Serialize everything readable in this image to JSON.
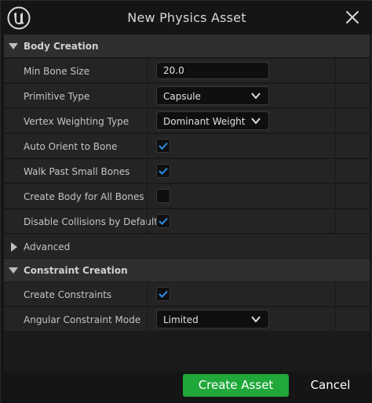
{
  "window": {
    "title": "New Physics Asset",
    "accent_color": "#20a83a",
    "check_color": "#2f8fe6"
  },
  "body_creation": {
    "title": "Body Creation",
    "min_bone_size": {
      "label": "Min Bone Size",
      "value": "20.0"
    },
    "primitive_type": {
      "label": "Primitive Type",
      "value": "Capsule"
    },
    "vertex_weighting_type": {
      "label": "Vertex Weighting Type",
      "value": "Dominant Weight"
    },
    "auto_orient": {
      "label": "Auto Orient to Bone",
      "checked": true
    },
    "walk_past_small": {
      "label": "Walk Past Small Bones",
      "checked": true
    },
    "create_body_all": {
      "label": "Create Body for All Bones",
      "checked": false
    },
    "disable_collisions": {
      "label": "Disable Collisions by Default",
      "checked": true
    }
  },
  "advanced": {
    "label": "Advanced"
  },
  "constraint_creation": {
    "title": "Constraint Creation",
    "create_constraints": {
      "label": "Create Constraints",
      "checked": true
    },
    "angular_mode": {
      "label": "Angular Constraint Mode",
      "value": "Limited"
    }
  },
  "footer": {
    "create_label": "Create Asset",
    "cancel_label": "Cancel"
  }
}
